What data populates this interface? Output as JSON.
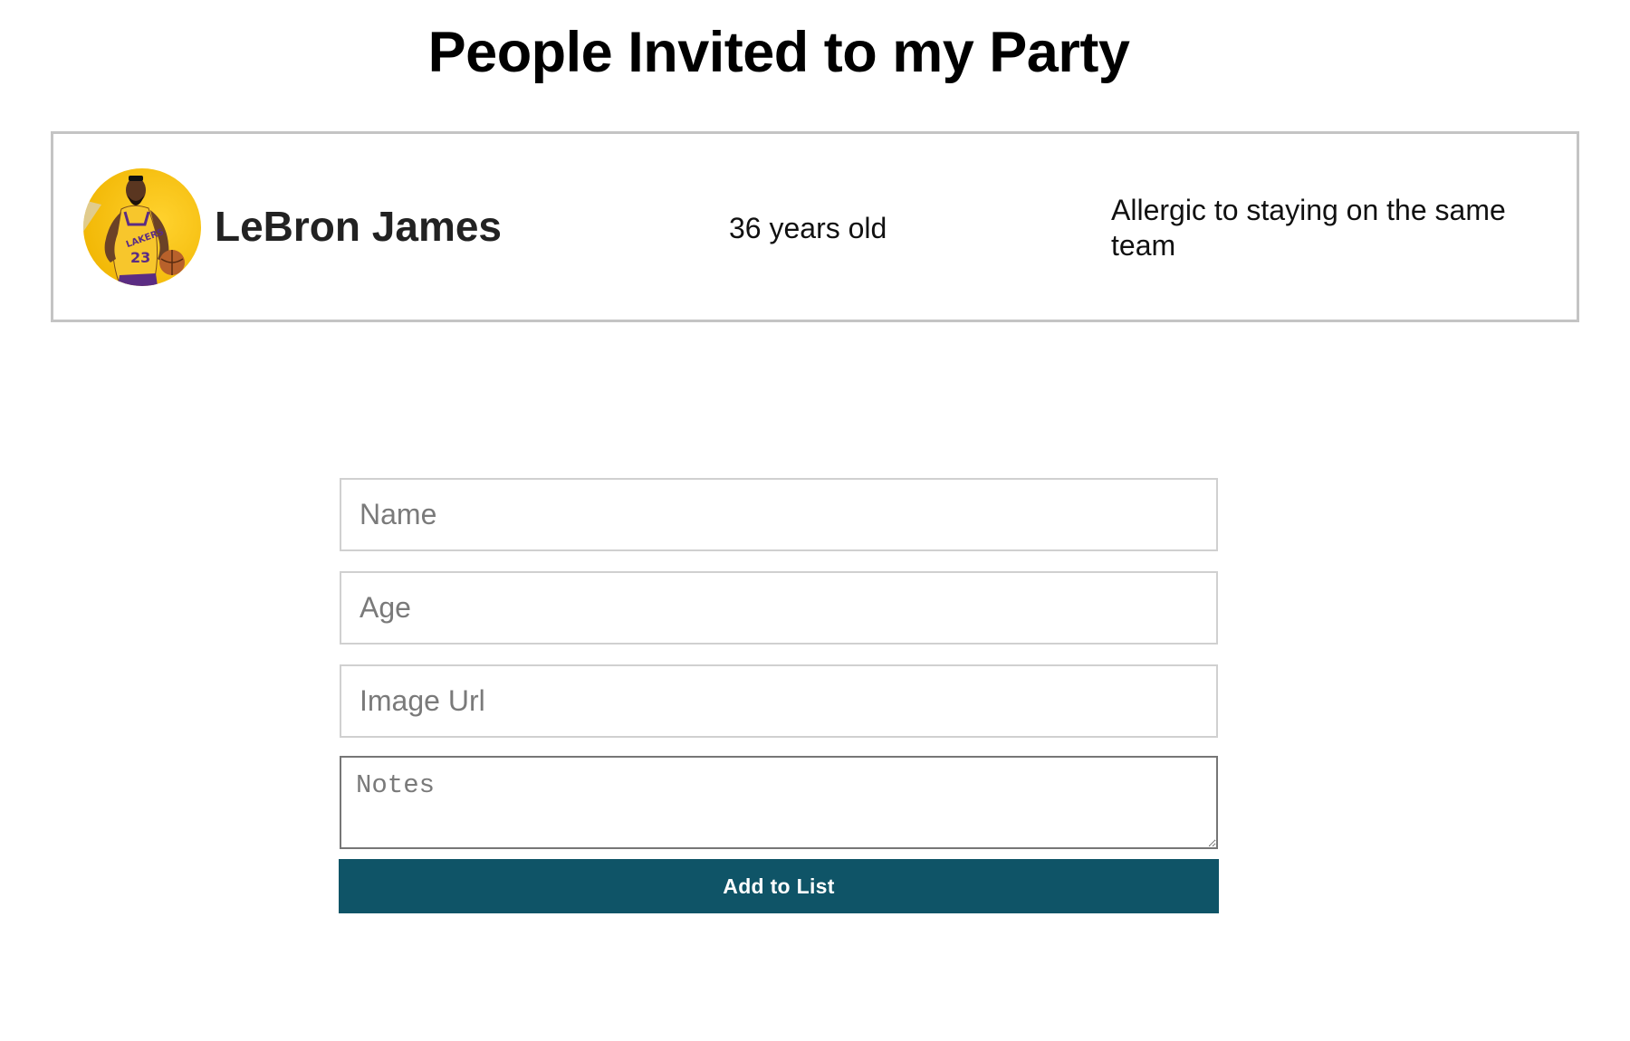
{
  "page": {
    "title": "People Invited to my Party"
  },
  "guests": [
    {
      "name": "LeBron James",
      "age_text": "36 years old",
      "note": "Allergic to staying on the same team",
      "avatar_icon": "player-photo-avatar"
    }
  ],
  "form": {
    "name_placeholder": "Name",
    "name_value": "",
    "age_placeholder": "Age",
    "age_value": "",
    "image_url_placeholder": "Image Url",
    "image_url_value": "",
    "notes_placeholder": "Notes",
    "notes_value": "",
    "submit_label": "Add to List"
  },
  "colors": {
    "button_bg": "#0f5467",
    "button_text": "#ffffff",
    "card_border": "#c4c4c4",
    "input_border": "#d0d0d0",
    "avatar_bg": "#f6c21a"
  }
}
